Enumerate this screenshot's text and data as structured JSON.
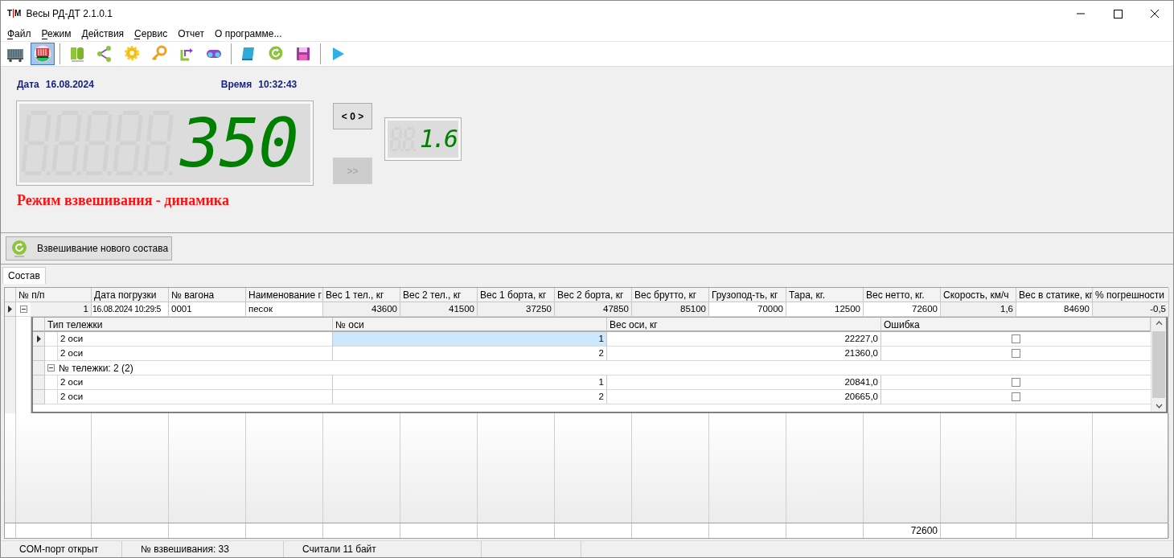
{
  "window": {
    "logo": [
      "T",
      "M"
    ],
    "title": "Весы РД-ДТ 2.1.0.1"
  },
  "menu": [
    {
      "label": "Файл",
      "mnemonic": true
    },
    {
      "label": "Режим",
      "mnemonic": true
    },
    {
      "label": "Действия",
      "mnemonic": false
    },
    {
      "label": "Сервис",
      "mnemonic": true
    },
    {
      "label": "Отчет",
      "mnemonic": false
    },
    {
      "label": "О программе...",
      "mnemonic": false
    }
  ],
  "toolbar": [
    {
      "kind": "button",
      "selected": false
    },
    {
      "kind": "button",
      "selected": true
    },
    {
      "kind": "separator"
    },
    {
      "kind": "button",
      "selected": false
    },
    {
      "kind": "button",
      "selected": false
    },
    {
      "kind": "button",
      "selected": false
    },
    {
      "kind": "button",
      "selected": false
    },
    {
      "kind": "button",
      "selected": false
    },
    {
      "kind": "button",
      "selected": false
    },
    {
      "kind": "separator"
    },
    {
      "kind": "button",
      "selected": false
    },
    {
      "kind": "button",
      "selected": false
    },
    {
      "kind": "button",
      "selected": false
    },
    {
      "kind": "separator"
    },
    {
      "kind": "button",
      "selected": false
    }
  ],
  "scale_panel": {
    "date_label": "Дата",
    "date": "16.08.2024",
    "time_label": "Время",
    "time": "10:32:43",
    "weight": "350",
    "zero_button": {
      "label": "< 0 >",
      "disabled": false
    },
    "next_button": {
      "label": ">>",
      "disabled": true
    },
    "speed": "1.6",
    "mode": "Режим взвешивания - динамика"
  },
  "new_train_button": "Взвешивание нового состава",
  "tabs": [
    {
      "label": "Состав",
      "selected": true
    }
  ],
  "table": {
    "columns": [
      "№ п/п",
      "Дата погрузки",
      "№ вагона",
      "Наименование г",
      "Вес 1 тел., кг",
      "Вес 2 тел., кг",
      "Вес 1 борта, кг",
      "Вес 2 борта, кг",
      "Вес брутто, кг",
      "Грузопод-ть, кг",
      "Тара, кг.",
      "Вес нетто, кг.",
      "Скорость, км/ч",
      "Вес в статике, кг",
      "% погрешности"
    ],
    "rows": [
      {
        "current": true,
        "expanded": true,
        "cells": [
          {
            "text": "1",
            "readonly": true
          },
          {
            "text": "16.08.2024 10:29:5",
            "readonly": false
          },
          {
            "text": "0001",
            "readonly": false
          },
          {
            "text": "песок",
            "readonly": false
          },
          {
            "text": "43600",
            "readonly": true
          },
          {
            "text": "41500",
            "readonly": true
          },
          {
            "text": "37250",
            "readonly": true
          },
          {
            "text": "47850",
            "readonly": true
          },
          {
            "text": "85100",
            "readonly": true
          },
          {
            "text": "70000",
            "readonly": false
          },
          {
            "text": "12500",
            "readonly": false
          },
          {
            "text": "72600",
            "readonly": false
          },
          {
            "text": "1,6",
            "readonly": true
          },
          {
            "text": "84690",
            "readonly": false
          },
          {
            "text": "-0,5",
            "readonly": true
          }
        ],
        "detail": {
          "columns": [
            "Тип тележки",
            "№ оси",
            "Вес оси, кг",
            "Ошибка"
          ],
          "items": [
            {
              "kind": "row",
              "selected": true,
              "type": "2 оси",
              "axle": "1",
              "weight": "22227,0",
              "error": false
            },
            {
              "kind": "row",
              "selected": false,
              "type": "2 оси",
              "axle": "2",
              "weight": "21360,0",
              "error": false
            },
            {
              "kind": "group",
              "label": "№ тележки: 2 (2)",
              "expanded": true,
              "children": [
                {
                  "kind": "row",
                  "selected": false,
                  "type": "2 оси",
                  "axle": "1",
                  "weight": "20841,0",
                  "error": false
                },
                {
                  "kind": "row",
                  "selected": false,
                  "type": "2 оси",
                  "axle": "2",
                  "weight": "20665,0",
                  "error": false
                }
              ]
            }
          ]
        }
      }
    ],
    "footer": {
      "net_weight_total": "72600"
    }
  },
  "status_bar": [
    "COM-порт открыт",
    "№ взвешивания: 33",
    "Считали 11 байт"
  ]
}
